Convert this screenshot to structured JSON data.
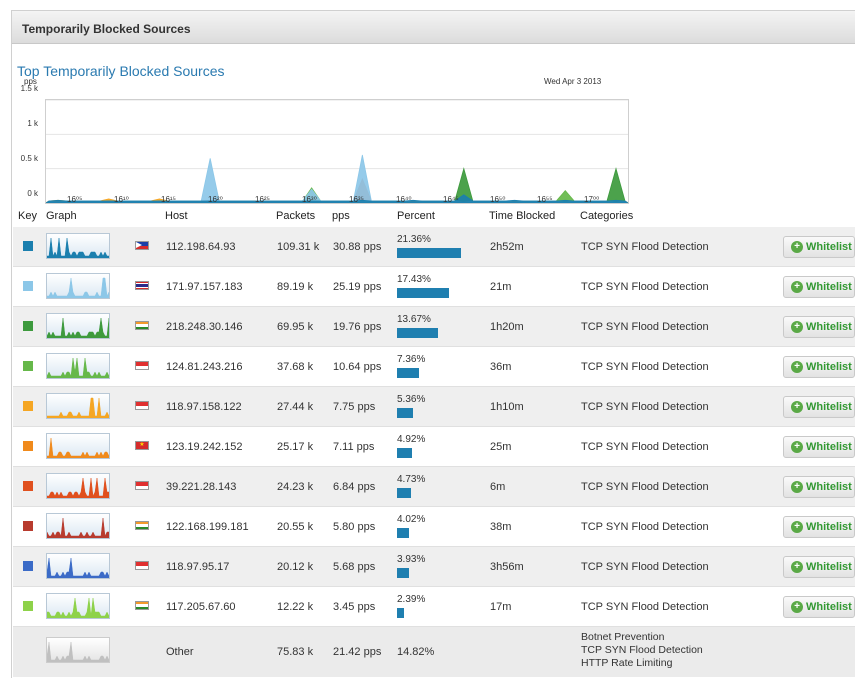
{
  "panel": {
    "title": "Temporarily Blocked Sources"
  },
  "chart": {
    "title": "Top Temporarily Blocked Sources",
    "date": "Wed Apr 3 2013",
    "unit": "pps",
    "y_ticks": [
      "1.5 k",
      "1 k",
      "0.5 k",
      "0 k"
    ],
    "x_ticks": [
      "16⁰⁵",
      "16¹⁰",
      "16¹⁵",
      "16²⁰",
      "16²⁵",
      "16³⁰",
      "16³⁵",
      "16⁴⁰",
      "16⁴⁵",
      "16⁵⁰",
      "16⁵⁵",
      "17⁰⁰"
    ]
  },
  "chart_data": {
    "type": "area",
    "title": "Top Temporarily Blocked Sources",
    "ylabel": "pps",
    "ylim": [
      0,
      1500
    ],
    "x": [
      "16:05",
      "16:10",
      "16:15",
      "16:20",
      "16:25",
      "16:30",
      "16:35",
      "16:40",
      "16:45",
      "16:50",
      "16:55",
      "17:00"
    ],
    "series": [
      {
        "name": "112.198.64.93",
        "color": "#1b7fae",
        "values": [
          40,
          30,
          30,
          30,
          30,
          30,
          40,
          40,
          120,
          40,
          40,
          40
        ]
      },
      {
        "name": "171.97.157.183",
        "color": "#8cc7e8",
        "values": [
          10,
          10,
          10,
          650,
          10,
          200,
          700,
          10,
          10,
          10,
          10,
          10
        ]
      },
      {
        "name": "218.248.30.146",
        "color": "#3d9a3d",
        "values": [
          0,
          0,
          0,
          0,
          0,
          0,
          0,
          0,
          500,
          0,
          0,
          500
        ]
      },
      {
        "name": "124.81.243.216",
        "color": "#66b84a",
        "values": [
          0,
          0,
          0,
          0,
          0,
          220,
          0,
          0,
          0,
          0,
          180,
          0
        ]
      },
      {
        "name": "118.97.158.122",
        "color": "#f5a623",
        "values": [
          40,
          60,
          60,
          20,
          20,
          100,
          20,
          20,
          20,
          20,
          20,
          20
        ]
      },
      {
        "name": "123.19.242.152",
        "color": "#f08a1c",
        "values": [
          20,
          30,
          20,
          20,
          20,
          40,
          20,
          20,
          20,
          20,
          20,
          20
        ]
      },
      {
        "name": "39.221.28.143",
        "color": "#e0501e",
        "values": [
          0,
          0,
          0,
          0,
          0,
          0,
          350,
          0,
          0,
          0,
          0,
          0
        ]
      },
      {
        "name": "122.168.199.181",
        "color": "#b83b2e",
        "values": [
          20,
          20,
          20,
          20,
          20,
          20,
          20,
          20,
          20,
          20,
          20,
          20
        ]
      },
      {
        "name": "118.97.95.17",
        "color": "#3b6bc7",
        "values": [
          10,
          10,
          10,
          10,
          10,
          10,
          10,
          10,
          10,
          10,
          10,
          10
        ]
      },
      {
        "name": "117.205.67.60",
        "color": "#8ed24a",
        "values": [
          10,
          10,
          10,
          10,
          10,
          10,
          10,
          10,
          10,
          10,
          10,
          10
        ]
      }
    ]
  },
  "columns": {
    "key": "Key",
    "graph": "Graph",
    "host": "Host",
    "packets": "Packets",
    "pps": "pps",
    "percent": "Percent",
    "time_blocked": "Time Blocked",
    "categories": "Categories"
  },
  "whitelist_label": "Whitelist",
  "rows": [
    {
      "color": "#1b7fae",
      "host": "112.198.64.93",
      "packets": "109.31 k",
      "pps": "30.88 pps",
      "percent": "21.36%",
      "pct": 21.36,
      "time": "2h52m",
      "category": "TCP SYN Flood Detection",
      "flag": "philippines"
    },
    {
      "color": "#8cc7e8",
      "host": "171.97.157.183",
      "packets": "89.19 k",
      "pps": "25.19 pps",
      "percent": "17.43%",
      "pct": 17.43,
      "time": "21m",
      "category": "TCP SYN Flood Detection",
      "flag": "thailand"
    },
    {
      "color": "#3d9a3d",
      "host": "218.248.30.146",
      "packets": "69.95 k",
      "pps": "19.76 pps",
      "percent": "13.67%",
      "pct": 13.67,
      "time": "1h20m",
      "category": "TCP SYN Flood Detection",
      "flag": "india"
    },
    {
      "color": "#66b84a",
      "host": "124.81.243.216",
      "packets": "37.68 k",
      "pps": "10.64 pps",
      "percent": "7.36%",
      "pct": 7.36,
      "time": "36m",
      "category": "TCP SYN Flood Detection",
      "flag": "indonesia"
    },
    {
      "color": "#f5a623",
      "host": "118.97.158.122",
      "packets": "27.44 k",
      "pps": "7.75 pps",
      "percent": "5.36%",
      "pct": 5.36,
      "time": "1h10m",
      "category": "TCP SYN Flood Detection",
      "flag": "indonesia"
    },
    {
      "color": "#f08a1c",
      "host": "123.19.242.152",
      "packets": "25.17 k",
      "pps": "7.11 pps",
      "percent": "4.92%",
      "pct": 4.92,
      "time": "25m",
      "category": "TCP SYN Flood Detection",
      "flag": "vietnam"
    },
    {
      "color": "#e0501e",
      "host": "39.221.28.143",
      "packets": "24.23 k",
      "pps": "6.84 pps",
      "percent": "4.73%",
      "pct": 4.73,
      "time": "6m",
      "category": "TCP SYN Flood Detection",
      "flag": "indonesia"
    },
    {
      "color": "#b83b2e",
      "host": "122.168.199.181",
      "packets": "20.55 k",
      "pps": "5.80 pps",
      "percent": "4.02%",
      "pct": 4.02,
      "time": "38m",
      "category": "TCP SYN Flood Detection",
      "flag": "india"
    },
    {
      "color": "#3b6bc7",
      "host": "118.97.95.17",
      "packets": "20.12 k",
      "pps": "5.68 pps",
      "percent": "3.93%",
      "pct": 3.93,
      "time": "3h56m",
      "category": "TCP SYN Flood Detection",
      "flag": "indonesia"
    },
    {
      "color": "#8ed24a",
      "host": "117.205.67.60",
      "packets": "12.22 k",
      "pps": "3.45 pps",
      "percent": "2.39%",
      "pct": 2.39,
      "time": "17m",
      "category": "TCP SYN Flood Detection",
      "flag": "india"
    }
  ],
  "other": {
    "host": "Other",
    "packets": "75.83 k",
    "pps": "21.42 pps",
    "percent": "14.82%",
    "categories": [
      "Botnet Prevention",
      "TCP SYN Flood Detection",
      "HTTP Rate Limiting"
    ]
  }
}
